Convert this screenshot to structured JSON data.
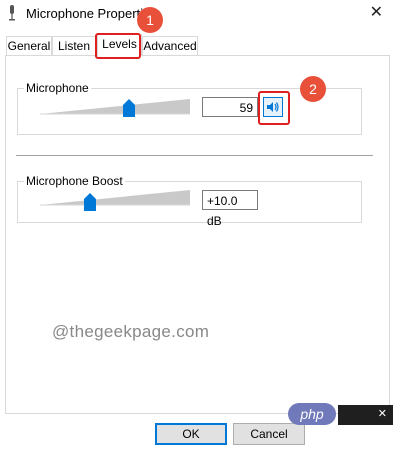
{
  "window": {
    "title": "Microphone Properties",
    "close_glyph": "✕"
  },
  "tabs": [
    {
      "label": "General"
    },
    {
      "label": "Listen"
    },
    {
      "label": "Levels",
      "active": true
    },
    {
      "label": "Advanced"
    }
  ],
  "levels": {
    "microphone": {
      "label": "Microphone",
      "value": "59",
      "level_percent": 59,
      "mute_icon": "speaker-icon"
    },
    "boost": {
      "label": "Microphone Boost",
      "value": "+10.0 dB"
    }
  },
  "callouts": {
    "one": "1",
    "two": "2"
  },
  "watermark": "@thegeekpage.com",
  "buttons": {
    "ok": "OK",
    "cancel": "Cancel"
  },
  "overlay": {
    "php": "php",
    "close": "✕"
  },
  "colors": {
    "accent": "#0078d7",
    "callout": "#e02020",
    "badge": "#e8503a"
  }
}
